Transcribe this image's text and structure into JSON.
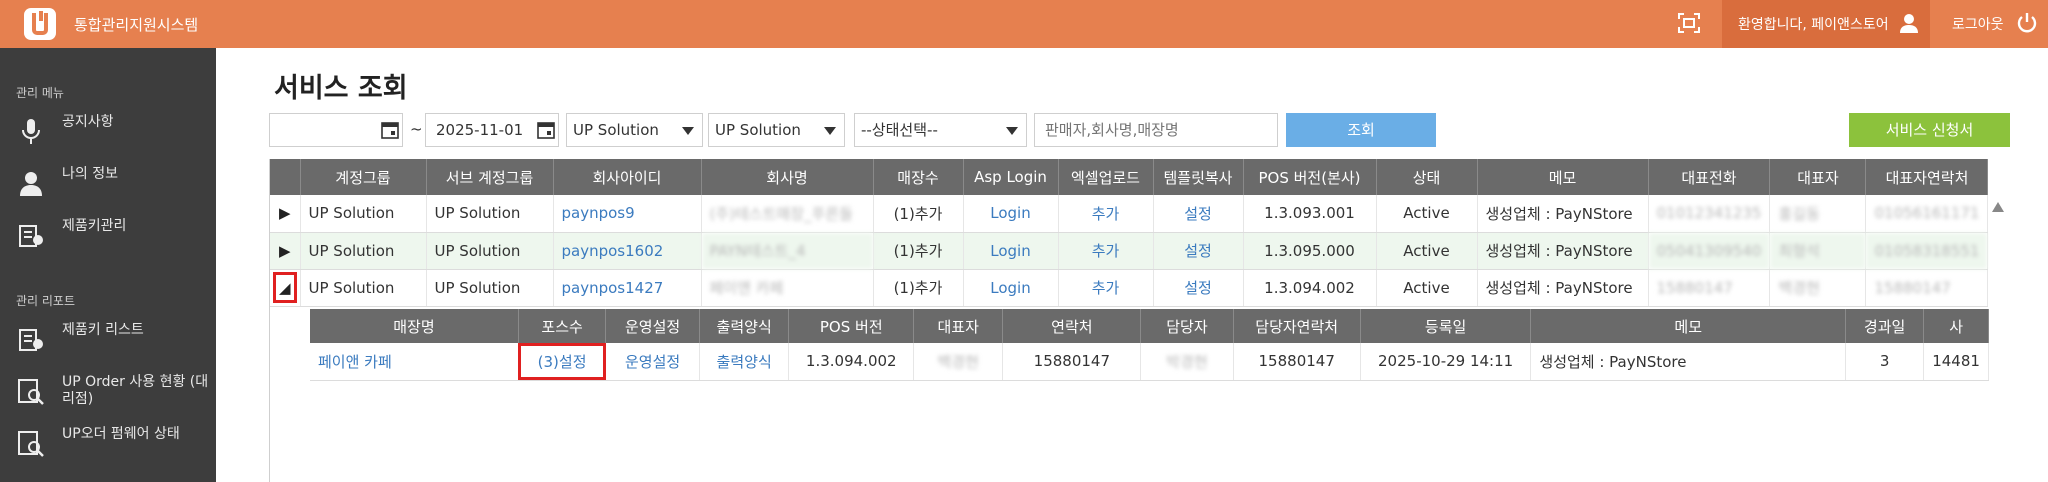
{
  "app": {
    "title": "통합관리지원시스템",
    "welcome": "환영합니다, 페이앤스토어",
    "logout": "로그아웃",
    "accent": "#e6804f"
  },
  "sidebar": {
    "section1": "관리 메뉴",
    "items1": [
      {
        "label": "공지사항",
        "icon": "microphone-icon"
      },
      {
        "label": "나의 정보",
        "icon": "user-icon"
      },
      {
        "label": "제품키관리",
        "icon": "key-list-icon"
      }
    ],
    "section2": "관리 리포트",
    "items2": [
      {
        "label": "제품키 리스트",
        "icon": "key-list-icon"
      },
      {
        "label": "UP Order 사용 현황 (대리점)",
        "icon": "report-search-icon"
      },
      {
        "label": "UP오더 펌웨어 상태",
        "icon": "report-search-icon"
      }
    ]
  },
  "page": {
    "title": "서비스 조회"
  },
  "filters": {
    "date_from": "",
    "tilde": "~",
    "date_to": "2025-11-01",
    "group": "UP Solution",
    "sub_group": "UP Solution",
    "status": "--상태선택--",
    "search_placeholder": "판매자,회사명,매장명",
    "search_button": "조회",
    "apply_button": "서비스 신청서"
  },
  "main_table": {
    "headers": [
      "계정그룹",
      "서브 계정그룹",
      "회사아이디",
      "회사명",
      "매장수",
      "Asp Login",
      "엑셀업로드",
      "템플릿복사",
      "POS 버전(본사)",
      "상태",
      "메모",
      "대표전화",
      "대표자",
      "대표자연락처"
    ],
    "rows": [
      {
        "group": "UP Solution",
        "sub_group": "UP Solution",
        "company_id": "paynpos9",
        "company_name": "(주)테스트매장_푸른들",
        "stores": "(1)추가",
        "asp": "Login",
        "excel": "추가",
        "template": "설정",
        "pos_version": "1.3.093.001",
        "status": "Active",
        "memo": "생성업체 : PayNStore",
        "phone": "01012341235",
        "ceo": "홍길동",
        "ceo_phone": "01056161171"
      },
      {
        "group": "UP Solution",
        "sub_group": "UP Solution",
        "company_id": "paynpos1602",
        "company_name": "PAYN테스트_4",
        "stores": "(1)추가",
        "asp": "Login",
        "excel": "추가",
        "template": "설정",
        "pos_version": "1.3.095.000",
        "status": "Active",
        "memo": "생성업체 : PayNStore",
        "phone": "05041309540",
        "ceo": "최형석",
        "ceo_phone": "01058318551"
      },
      {
        "group": "UP Solution",
        "sub_group": "UP Solution",
        "company_id": "paynpos1427",
        "company_name": "페이앤 카페",
        "stores": "(1)추가",
        "asp": "Login",
        "excel": "추가",
        "template": "설정",
        "pos_version": "1.3.094.002",
        "status": "Active",
        "memo": "생성업체 : PayNStore",
        "phone": "15880147",
        "ceo": "백경현",
        "ceo_phone": "15880147"
      }
    ]
  },
  "sub_table": {
    "headers": [
      "매장명",
      "포스수",
      "운영설정",
      "출력양식",
      "POS 버전",
      "대표자",
      "연락처",
      "담당자",
      "담당자연락처",
      "등록일",
      "메모",
      "경과일",
      "사"
    ],
    "row": {
      "store_name": "페이앤 카페",
      "pos_count": "(3)설정",
      "ops": "운영설정",
      "print": "출력양식",
      "pos_version": "1.3.094.002",
      "ceo": "백경현",
      "phone": "15880147",
      "manager": "박경현",
      "manager_phone": "15880147",
      "registered": "2025-10-29 14:11",
      "memo": "생성업체 : PayNStore",
      "elapsed": "3",
      "extra": "14481"
    }
  }
}
